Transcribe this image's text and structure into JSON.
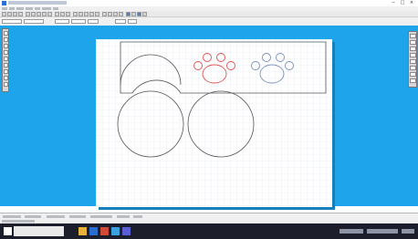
{
  "window": {
    "title": "",
    "controls": [
      "−",
      "□",
      "×"
    ]
  },
  "menu": {
    "items": [
      "",
      "",
      "",
      "",
      "",
      "",
      ""
    ]
  },
  "toolbar": {
    "coordinate_fields": [
      "",
      "",
      "",
      "",
      "",
      "",
      ""
    ]
  },
  "bottom_tabs": {
    "tabs": [
      "",
      "",
      "",
      "",
      "",
      "",
      ""
    ],
    "status": ""
  },
  "taskbar": {
    "search_placeholder": "",
    "clock": ""
  },
  "canvas": {
    "theme": {
      "workspace": "#1ea4ea",
      "sheet": "#ffffff",
      "grid": "#dde5ef",
      "outline": "#555555",
      "paw_red": "#e05050",
      "paw_blue": "#7a90b8"
    },
    "shapes": [
      "panel-outline-with-circle-notch",
      "red-paw-print",
      "blue-paw-print",
      "large-circle-left",
      "large-circle-right"
    ]
  }
}
